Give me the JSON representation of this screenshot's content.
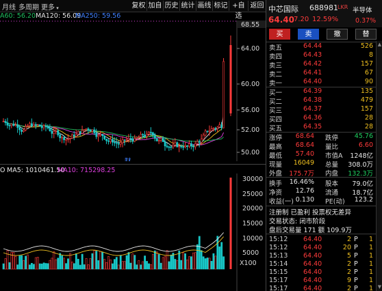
{
  "toolbar": {
    "left": [
      "月线",
      "多周期",
      "更多"
    ],
    "buttons": [
      "复权",
      "加自",
      "历史",
      "统计",
      "画线",
      "标记",
      "+自选",
      "返回"
    ]
  },
  "ma_legend": {
    "ma60": "A60: 56.20",
    "ma120": "MA120: 56.09",
    "ma250": "MA250: 59.56"
  },
  "price_axis": [
    "68.55",
    "64.00",
    "60.00",
    "56.00",
    "52.00",
    "50.00"
  ],
  "price_chart_tag": "财",
  "vol_legend": {
    "prefix": "O",
    "ma5": "MA5: 1010461.50",
    "ma10": "MA10: 715298.25"
  },
  "vol_axis": [
    "30000",
    "25000",
    "20000",
    "15000",
    "10000",
    "5000",
    "X100"
  ],
  "header": {
    "name": "中芯国际",
    "code": "688981",
    "tag": "LKR",
    "price": "64.40",
    "change": "7.20",
    "change_pct": "12.59%",
    "sector": "半导体",
    "sector_pct": "0.37%"
  },
  "trade_buttons": [
    "买",
    "卖",
    "撤",
    "替"
  ],
  "asks": [
    {
      "label": "卖五",
      "price": "64.44",
      "qty": "526"
    },
    {
      "label": "卖四",
      "price": "64.43",
      "qty": "8"
    },
    {
      "label": "卖三",
      "price": "64.42",
      "qty": "157"
    },
    {
      "label": "卖二",
      "price": "64.41",
      "qty": "67"
    },
    {
      "label": "卖一",
      "price": "64.40",
      "qty": "90"
    }
  ],
  "bids": [
    {
      "label": "买一",
      "price": "64.39",
      "qty": "135"
    },
    {
      "label": "买二",
      "price": "64.38",
      "qty": "479"
    },
    {
      "label": "买三",
      "price": "64.37",
      "qty": "157"
    },
    {
      "label": "买四",
      "price": "64.36",
      "qty": "28"
    },
    {
      "label": "买五",
      "price": "64.35",
      "qty": "28"
    }
  ],
  "stats": [
    {
      "l1": "涨停",
      "v1": "68.64",
      "c1": "red",
      "l2": "跌停",
      "v2": "45.76",
      "c2": "green"
    },
    {
      "l1": "最高",
      "v1": "68.64",
      "c1": "red",
      "l2": "量比",
      "v2": "6.60",
      "c2": "red"
    },
    {
      "l1": "最低",
      "v1": "57.40",
      "c1": "red",
      "l2": "市值A",
      "v2": "1248亿",
      "c2": "white"
    },
    {
      "l1": "现量",
      "v1": "16049",
      "c1": "yellow",
      "l2": "总量",
      "v2": "308.0万",
      "c2": "white"
    },
    {
      "l1": "外盘",
      "v1": "175.7万",
      "c1": "red",
      "l2": "内盘",
      "v2": "132.3万",
      "c2": "green"
    }
  ],
  "stats2": [
    {
      "l1": "换手",
      "v1": "16.46%",
      "c1": "white",
      "l2": "股本",
      "v2": "79.0亿",
      "c2": "white"
    },
    {
      "l1": "净资",
      "v1": "12.76",
      "c1": "white",
      "l2": "流通",
      "v2": "18.7亿",
      "c2": "white"
    },
    {
      "l1": "收益(一)",
      "v1": "0.130",
      "c1": "white",
      "l2": "PE(动)",
      "v2": "123.2",
      "c2": "white"
    }
  ],
  "info": {
    "line1": "注册制 已盈利 投票权无差异",
    "line2": "交易状态: 闭市阶段",
    "line3": "盘后交易量 171 额 109.9万"
  },
  "ticks": [
    {
      "time": "15:12",
      "price": "64.40",
      "vol": "2",
      "flag": "P",
      "n": "1"
    },
    {
      "time": "15:12",
      "price": "64.40",
      "vol": "20",
      "flag": "P",
      "n": "1"
    },
    {
      "time": "15:13",
      "price": "64.40",
      "vol": "5",
      "flag": "P",
      "n": "1"
    },
    {
      "time": "15:14",
      "price": "64.40",
      "vol": "2",
      "flag": "P",
      "n": "1"
    },
    {
      "time": "15:15",
      "price": "64.40",
      "vol": "2",
      "flag": "P",
      "n": "1"
    },
    {
      "time": "15:17",
      "price": "64.40",
      "vol": "9",
      "flag": "P",
      "n": "1"
    },
    {
      "time": "15:17",
      "price": "64.40",
      "vol": "2",
      "flag": "P",
      "n": "1"
    }
  ],
  "colors": {
    "up": "#ff3b3b",
    "down": "#18c8c8",
    "ma5": "#e8e8e8",
    "ma10": "#f0c020",
    "ma20": "#e040e0",
    "ma60": "#20c060"
  }
}
